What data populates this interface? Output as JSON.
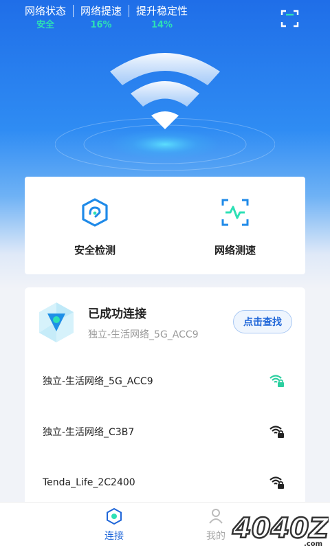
{
  "header": {
    "stats": [
      {
        "label": "网络状态",
        "value": "安全"
      },
      {
        "label": "网络提速",
        "value": "16%"
      },
      {
        "label": "提升稳定性",
        "value": "14%"
      }
    ]
  },
  "features": [
    {
      "label": "安全检测",
      "icon": "shield-cube-icon"
    },
    {
      "label": "网络测速",
      "icon": "speed-test-icon"
    }
  ],
  "connection": {
    "title": "已成功连接",
    "ssid": "独立-生活网络_5G_ACC9",
    "find_button": "点击查找",
    "icon": "connection-gem-icon"
  },
  "networks": [
    {
      "name": "独立-生活网络_5G_ACC9",
      "icon": "wifi-lock-icon",
      "color": "#2ccfa0"
    },
    {
      "name": "独立-生活网络_C3B7",
      "icon": "wifi-lock-icon",
      "color": "#222222"
    },
    {
      "name": "Tenda_Life_2C2400",
      "icon": "wifi-lock-icon",
      "color": "#222222"
    }
  ],
  "tabs": [
    {
      "label": "连接",
      "active": true
    },
    {
      "label": "我的",
      "active": false
    }
  ],
  "watermark": "4040Z.com",
  "colors": {
    "accent": "#1f66d8",
    "success": "#2de0b5"
  }
}
